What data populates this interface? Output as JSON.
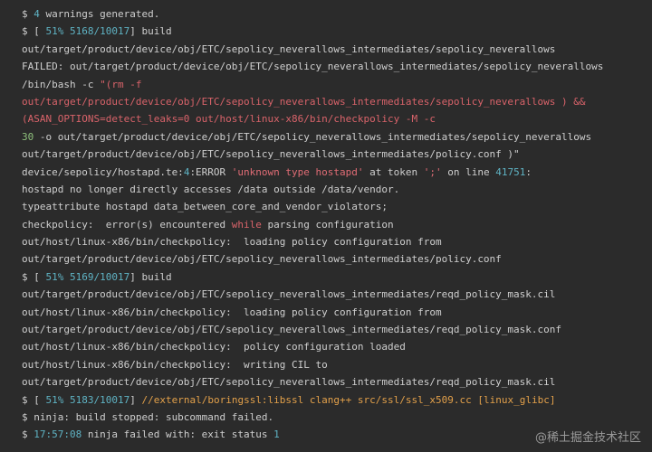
{
  "colors": {
    "default": "#cfcfcf",
    "cyan": "#5fb3c4",
    "red": "#d9636a",
    "string": "#e06c75",
    "orange": "#e2a04a",
    "green": "#8ec07c",
    "comment": "#8a8a8a"
  },
  "lines": [
    [
      {
        "t": "$ ",
        "c": "default"
      },
      {
        "t": "4",
        "c": "cyan"
      },
      {
        "t": " warnings generated.",
        "c": "default"
      }
    ],
    [
      {
        "t": "$ [ ",
        "c": "default"
      },
      {
        "t": "51%",
        "c": "cyan"
      },
      {
        "t": " ",
        "c": "default"
      },
      {
        "t": "5168/10017",
        "c": "cyan"
      },
      {
        "t": "] build",
        "c": "default"
      }
    ],
    [
      {
        "t": "out/target/product/device/obj/ETC/sepolicy_neverallows_intermediates/sepolicy_neverallows",
        "c": "default"
      }
    ],
    [
      {
        "t": "FAILED: out/target/product/device/obj/ETC/sepolicy_neverallows_intermediates/sepolicy_neverallows",
        "c": "default"
      }
    ],
    [
      {
        "t": "/bin/bash -c ",
        "c": "default"
      },
      {
        "t": "\"(rm -f",
        "c": "red"
      }
    ],
    [
      {
        "t": "out/target/product/device/obj/ETC/sepolicy_neverallows_intermediates/sepolicy_neverallows ) &&",
        "c": "red"
      }
    ],
    [
      {
        "t": "(ASAN_OPTIONS=detect_leaks=0 out/host/linux-x86/bin/checkpolicy -M -c",
        "c": "red"
      }
    ],
    [
      {
        "t": "30",
        "c": "green"
      },
      {
        "t": " -o out/target/product/device/obj/ETC/sepolicy_neverallows_intermediates/sepolicy_neverallows",
        "c": "default"
      }
    ],
    [
      {
        "t": "out/target/product/device/obj/ETC/sepolicy_neverallows_intermediates/policy.conf )\"",
        "c": "default"
      }
    ],
    [
      {
        "t": "device/sepolicy/hostapd.te:",
        "c": "default"
      },
      {
        "t": "4",
        "c": "cyan"
      },
      {
        "t": ":ERROR ",
        "c": "default"
      },
      {
        "t": "'unknown type hostapd'",
        "c": "string"
      },
      {
        "t": " at token ",
        "c": "default"
      },
      {
        "t": "';'",
        "c": "string"
      },
      {
        "t": " on line ",
        "c": "default"
      },
      {
        "t": "41751",
        "c": "cyan"
      },
      {
        "t": ":",
        "c": "default"
      }
    ],
    [
      {
        "t": "hostapd no longer directly accesses /data outside /data/vendor.",
        "c": "default"
      }
    ],
    [
      {
        "t": "typeattribute hostapd data_between_core_and_vendor_violators;",
        "c": "default"
      }
    ],
    [
      {
        "t": "checkpolicy:  error(s) encountered ",
        "c": "default"
      },
      {
        "t": "while",
        "c": "red"
      },
      {
        "t": " parsing configuration",
        "c": "default"
      }
    ],
    [
      {
        "t": "out/host/linux-x86/bin/checkpolicy:  loading policy configuration ",
        "c": "default"
      },
      {
        "t": "from",
        "c": "default"
      }
    ],
    [
      {
        "t": "out/target/product/device/obj/ETC/sepolicy_neverallows_intermediates/policy.conf",
        "c": "default"
      }
    ],
    [
      {
        "t": "$ [ ",
        "c": "default"
      },
      {
        "t": "51%",
        "c": "cyan"
      },
      {
        "t": " ",
        "c": "default"
      },
      {
        "t": "5169/10017",
        "c": "cyan"
      },
      {
        "t": "] build",
        "c": "default"
      }
    ],
    [
      {
        "t": "out/target/product/device/obj/ETC/sepolicy_neverallows_intermediates/reqd_policy_mask.cil",
        "c": "default"
      }
    ],
    [
      {
        "t": "out/host/linux-x86/bin/checkpolicy:  loading policy configuration from",
        "c": "default"
      }
    ],
    [
      {
        "t": "out/target/product/device/obj/ETC/sepolicy_neverallows_intermediates/reqd_policy_mask.conf",
        "c": "default"
      }
    ],
    [
      {
        "t": "out/host/linux-x86/bin/checkpolicy:  policy configuration loaded",
        "c": "default"
      }
    ],
    [
      {
        "t": "out/host/linux-x86/bin/checkpolicy:  writing CIL to",
        "c": "default"
      }
    ],
    [
      {
        "t": "out/target/product/device/obj/ETC/sepolicy_neverallows_intermediates/reqd_policy_mask.cil",
        "c": "default"
      }
    ],
    [
      {
        "t": "$ [ ",
        "c": "default"
      },
      {
        "t": "51%",
        "c": "cyan"
      },
      {
        "t": " ",
        "c": "default"
      },
      {
        "t": "5183/10017",
        "c": "cyan"
      },
      {
        "t": "] ",
        "c": "default"
      },
      {
        "t": "//external/boringssl:libssl clang++ src/ssl/ssl_x509.cc [linux_glibc]",
        "c": "orange"
      }
    ],
    [
      {
        "t": "$ ninja: build stopped: subcommand failed.",
        "c": "default"
      }
    ],
    [
      {
        "t": "$ ",
        "c": "default"
      },
      {
        "t": "17:57:08",
        "c": "cyan"
      },
      {
        "t": " ninja failed with: exit status ",
        "c": "default"
      },
      {
        "t": "1",
        "c": "cyan"
      }
    ]
  ],
  "watermark": "@稀土掘金技术社区"
}
